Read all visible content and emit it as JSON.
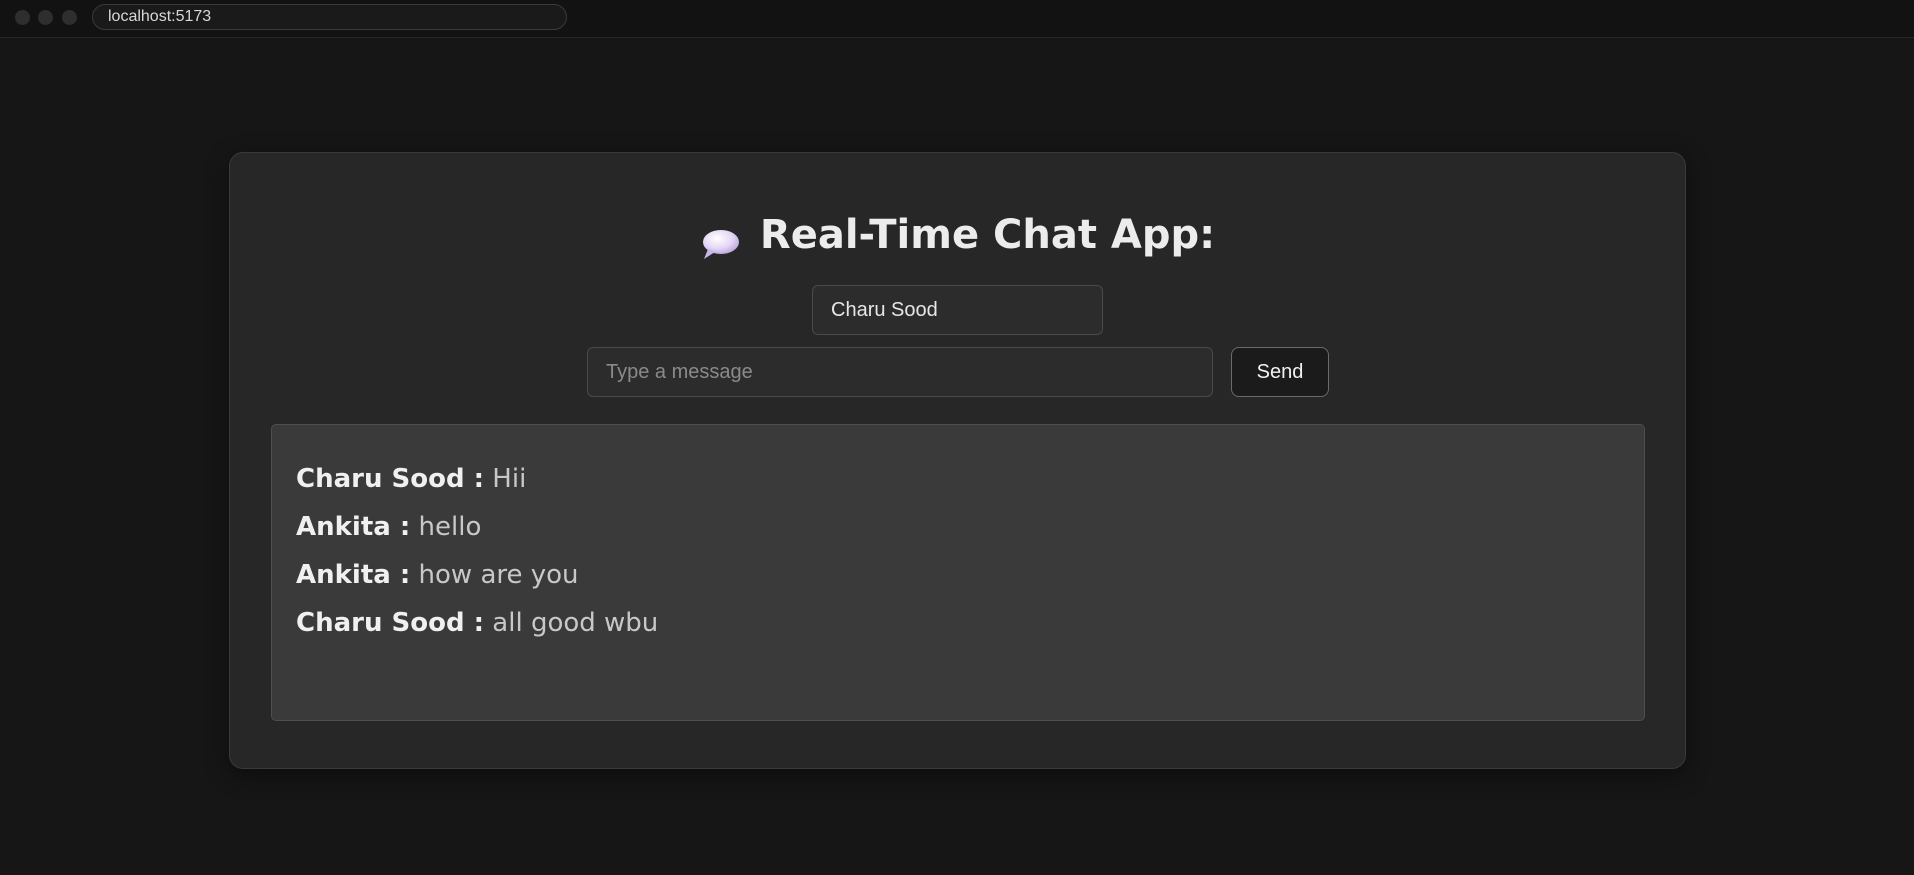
{
  "browser": {
    "url": "localhost:5173"
  },
  "app": {
    "title": "Real-Time Chat App:",
    "title_icon": "speech-bubble-icon"
  },
  "form": {
    "name_value": "Charu Sood",
    "message_placeholder": "Type a message",
    "message_value": "",
    "send_label": "Send"
  },
  "messages": [
    {
      "sender": "Charu Sood :",
      "text": "Hii"
    },
    {
      "sender": "Ankita :",
      "text": "hello"
    },
    {
      "sender": "Ankita :",
      "text": "how are you"
    },
    {
      "sender": "Charu Sood :",
      "text": "all good wbu"
    }
  ],
  "colors": {
    "background": "#161616",
    "card": "#272727",
    "messages_panel": "#3a3a3a",
    "bubble_icon": "#d9c8f0"
  }
}
